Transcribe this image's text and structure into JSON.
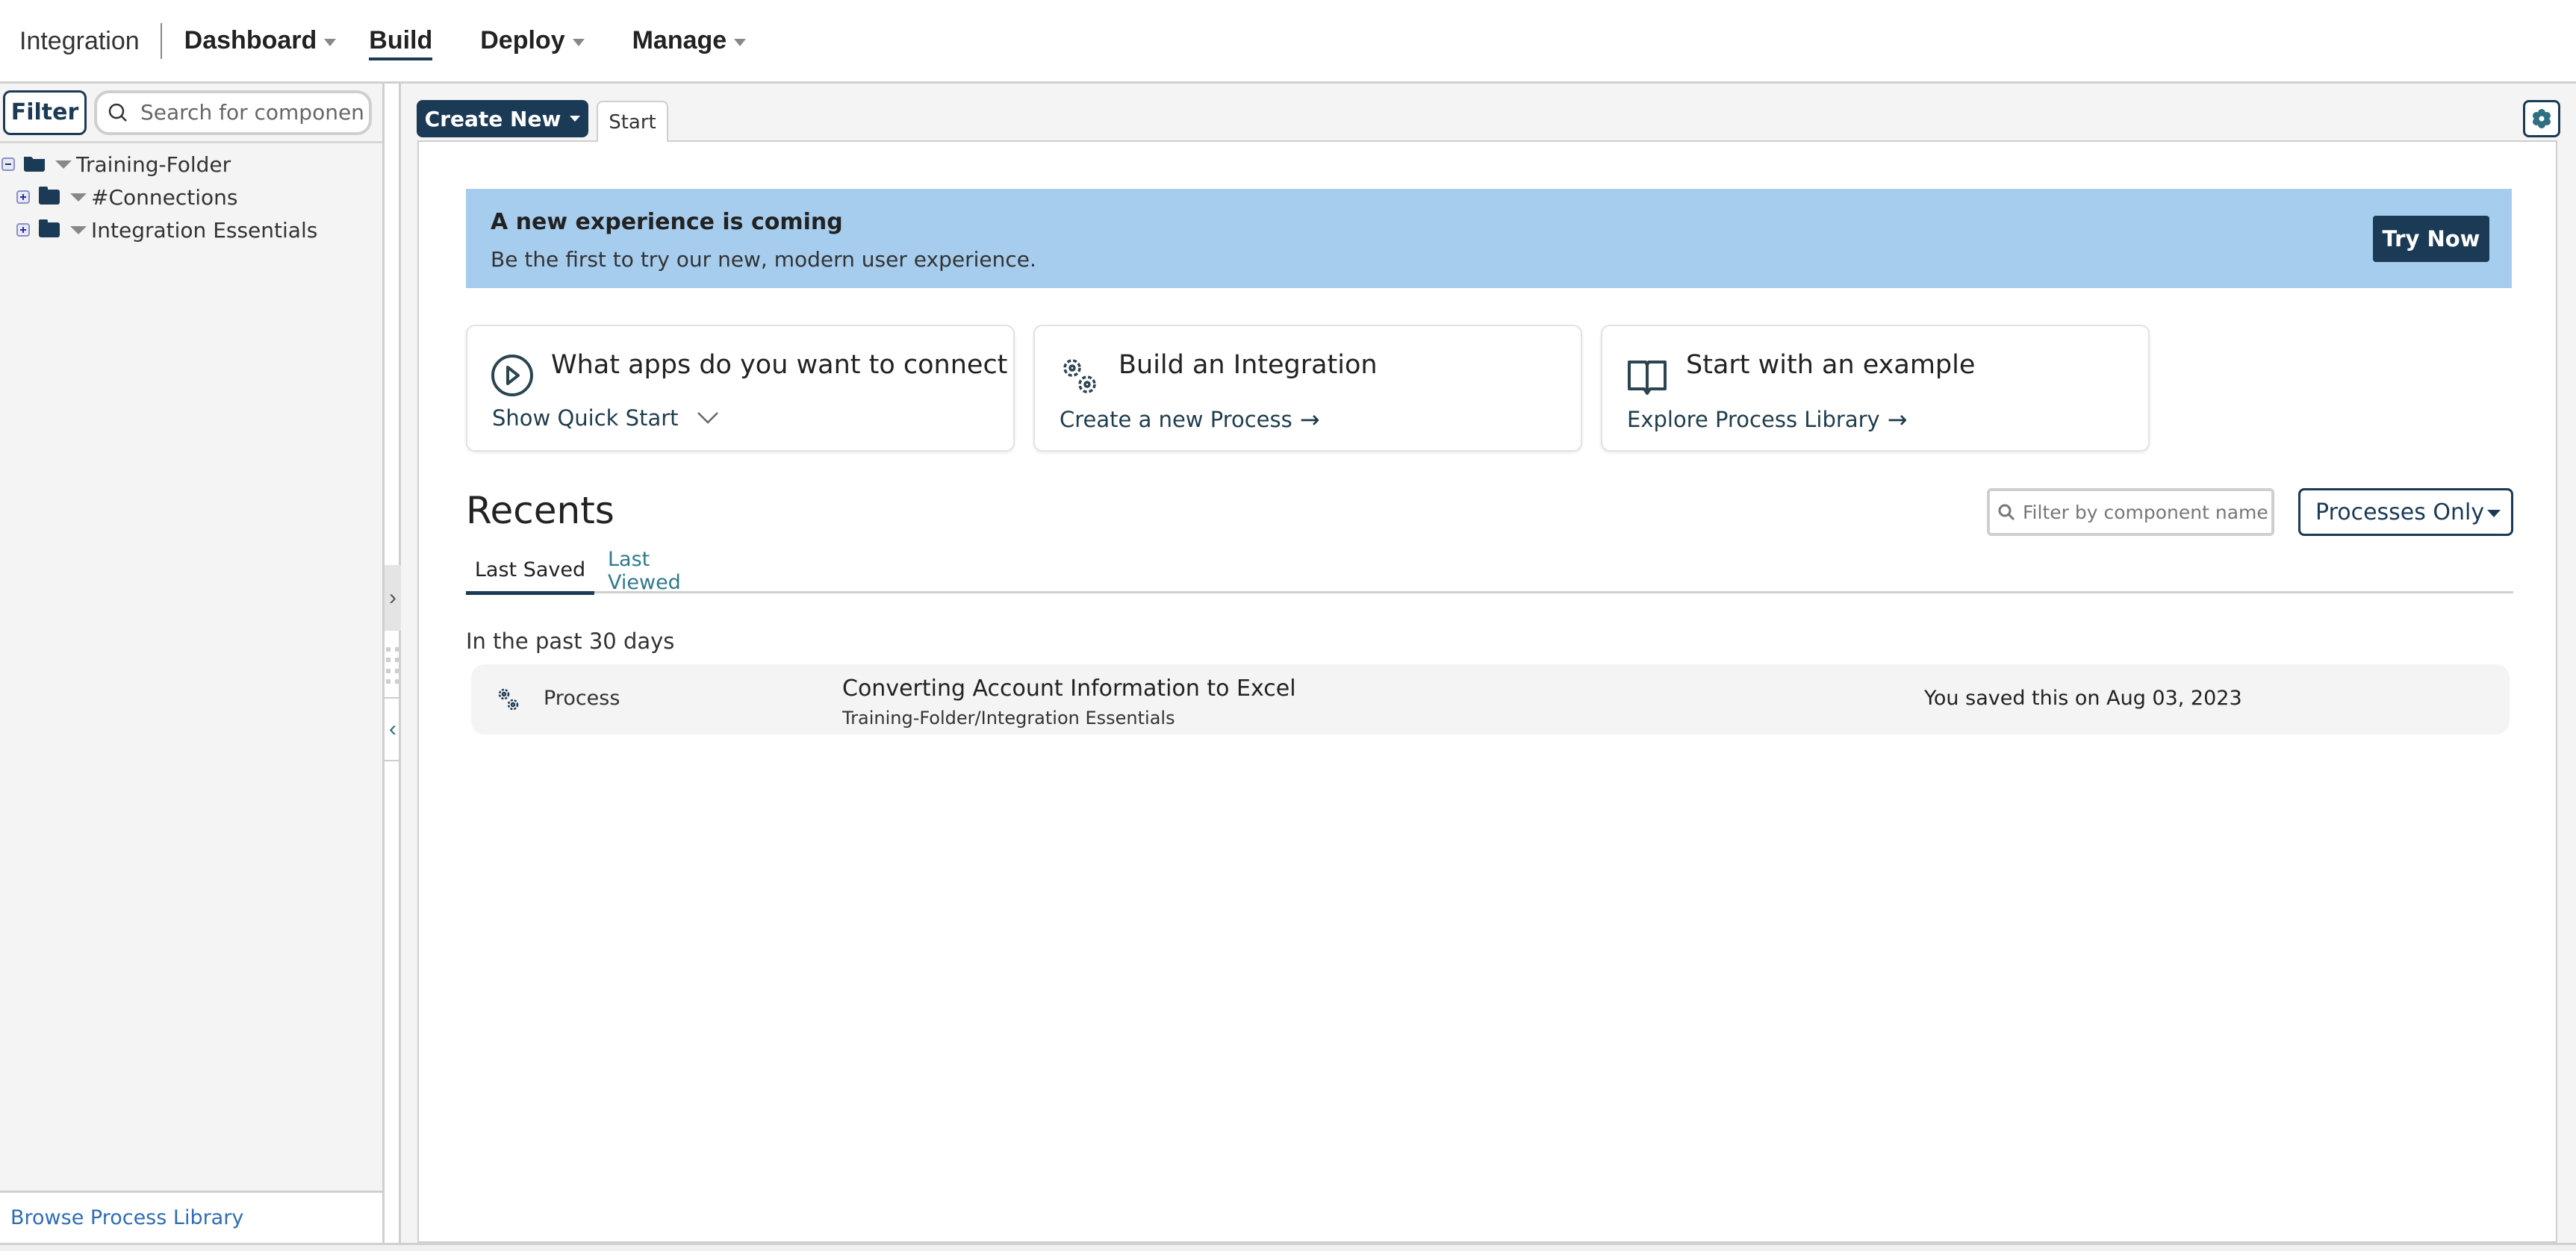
{
  "nav": {
    "brand": "Integration",
    "items": [
      {
        "label": "Dashboard",
        "has_dropdown": true,
        "active": false
      },
      {
        "label": "Build",
        "has_dropdown": false,
        "active": true
      },
      {
        "label": "Deploy",
        "has_dropdown": true,
        "active": false
      },
      {
        "label": "Manage",
        "has_dropdown": true,
        "active": false
      }
    ]
  },
  "sidebar": {
    "filter_label": "Filter",
    "search_placeholder": "Search for component or folder",
    "tree": [
      {
        "label": "Training-Folder",
        "expanded": true,
        "level": 0,
        "icon": "folder-open-icon"
      },
      {
        "label": "#Connections",
        "expanded": false,
        "level": 1,
        "icon": "folder-icon"
      },
      {
        "label": "Integration Essentials",
        "expanded": false,
        "level": 1,
        "icon": "folder-icon"
      }
    ],
    "footer_link": "Browse Process Library"
  },
  "toolbar": {
    "create_new_label": "Create New",
    "tabs": [
      {
        "label": "Start",
        "active": true
      }
    ],
    "settings_icon": "gear-icon"
  },
  "banner": {
    "title": "A new experience is coming",
    "subtitle": "Be the first to try our new, modern user experience.",
    "button_label": "Try Now",
    "background": "#a6cdee"
  },
  "cards": [
    {
      "title": "What apps do you want to connect",
      "link": "Show Quick Start",
      "icon": "play-circle-icon",
      "link_icon": "chevron-down-icon"
    },
    {
      "title": "Build an Integration",
      "link": "Create a new Process",
      "icon": "gears-icon",
      "link_icon": "arrow-right-icon"
    },
    {
      "title": "Start with an example",
      "link": "Explore Process Library",
      "icon": "book-icon",
      "link_icon": "arrow-right-icon"
    }
  ],
  "recents": {
    "title": "Recents",
    "filter_placeholder": "Filter by component name",
    "type_filter": "Processes Only",
    "tabs": [
      {
        "label": "Last Saved",
        "active": true
      },
      {
        "label": "Last Viewed",
        "active": false
      }
    ],
    "period_label": "In the past 30 days",
    "items": [
      {
        "type": "Process",
        "name": "Converting Account Information to Excel",
        "path": "Training-Folder/Integration Essentials",
        "saved": "You saved this on Aug 03, 2023"
      }
    ]
  },
  "colors": {
    "primary": "#1b3a55",
    "link": "#2f6db5",
    "accent_teal": "#2f7a8a"
  }
}
